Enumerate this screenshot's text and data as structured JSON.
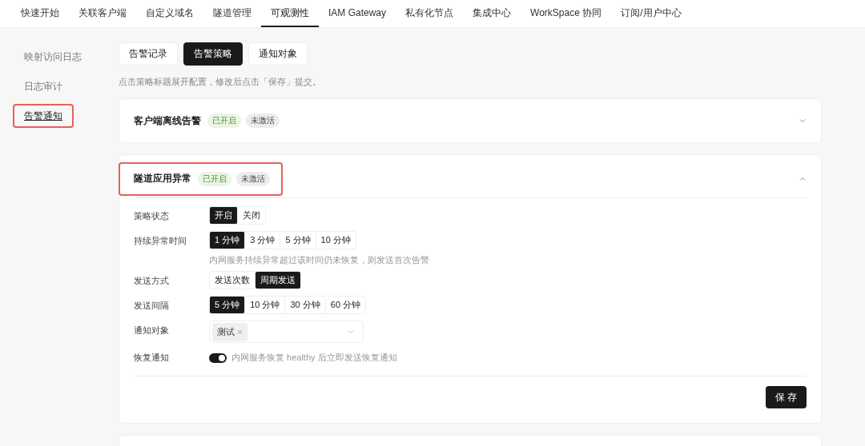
{
  "top_nav": [
    {
      "label": "快速开始",
      "selected": false
    },
    {
      "label": "关联客户端",
      "selected": false
    },
    {
      "label": "自定义域名",
      "selected": false
    },
    {
      "label": "隧道管理",
      "selected": false
    },
    {
      "label": "可观测性",
      "selected": true
    },
    {
      "label": "IAM Gateway",
      "selected": false
    },
    {
      "label": "私有化节点",
      "selected": false
    },
    {
      "label": "集成中心",
      "selected": false
    },
    {
      "label": "WorkSpace 协同",
      "selected": false
    },
    {
      "label": "订阅/用户中心",
      "selected": false
    }
  ],
  "sidebar": {
    "items": [
      {
        "label": "映射访问日志",
        "selected": false,
        "highlighted": false
      },
      {
        "label": "日志审计",
        "selected": false,
        "highlighted": false
      },
      {
        "label": "告警通知",
        "selected": true,
        "highlighted": true
      }
    ]
  },
  "tabs": [
    {
      "label": "告警记录",
      "selected": false
    },
    {
      "label": "告警策略",
      "selected": true
    },
    {
      "label": "通知对象",
      "selected": false
    }
  ],
  "hint": "点击策略标题展开配置，修改后点击「保存」提交。",
  "policies": [
    {
      "title": "客户端离线告警",
      "badges": [
        {
          "label": "已开启",
          "kind": "success"
        },
        {
          "label": "未激活",
          "kind": "neutral"
        }
      ],
      "expanded": false,
      "highlighted": false
    },
    {
      "title": "隧道应用异常",
      "badges": [
        {
          "label": "已开启",
          "kind": "success"
        },
        {
          "label": "未激活",
          "kind": "neutral"
        }
      ],
      "expanded": true,
      "highlighted": true,
      "settings": [
        {
          "kind": "segmented",
          "label": "策略状态",
          "options": [
            {
              "label": "开启",
              "selected": true
            },
            {
              "label": "关闭",
              "selected": false
            }
          ]
        },
        {
          "kind": "segmented",
          "label": "持续异常时间",
          "options": [
            {
              "label": "1 分钟",
              "selected": true
            },
            {
              "label": "3 分钟",
              "selected": false
            },
            {
              "label": "5 分钟",
              "selected": false
            },
            {
              "label": "10 分钟",
              "selected": false
            }
          ],
          "help": "内网服务持续异常超过该时间仍未恢复，则发送首次告警"
        },
        {
          "kind": "segmented",
          "label": "发送方式",
          "options": [
            {
              "label": "发送次数",
              "selected": false
            },
            {
              "label": "周期发送",
              "selected": true
            }
          ]
        },
        {
          "kind": "segmented",
          "label": "发送间隔",
          "options": [
            {
              "label": "5 分钟",
              "selected": true
            },
            {
              "label": "10 分钟",
              "selected": false
            },
            {
              "label": "30 分钟",
              "selected": false
            },
            {
              "label": "60 分钟",
              "selected": false
            }
          ]
        },
        {
          "kind": "select",
          "label": "通知对象",
          "tags": [
            "测试"
          ]
        },
        {
          "kind": "switch",
          "label": "恢复通知",
          "on": true,
          "help": "内网服务恢复 healthy 后立即发送恢复通知"
        }
      ],
      "save_button": "保 存"
    }
  ]
}
